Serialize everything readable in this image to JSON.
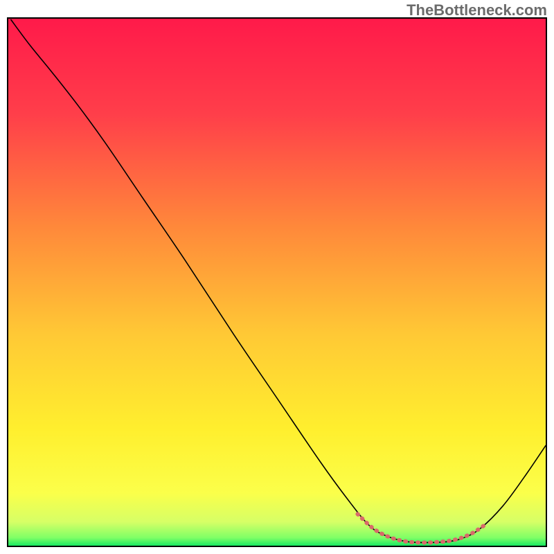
{
  "watermark": "TheBottleneck.com",
  "chart_data": {
    "type": "line",
    "title": "",
    "xlabel": "",
    "ylabel": "",
    "xlim": [
      0,
      100
    ],
    "ylim": [
      0,
      100
    ],
    "grid": false,
    "legend": null,
    "gradient_stops": [
      {
        "offset": 0.0,
        "color": "#ff1a4a"
      },
      {
        "offset": 0.18,
        "color": "#ff3e4a"
      },
      {
        "offset": 0.4,
        "color": "#ff8a3a"
      },
      {
        "offset": 0.6,
        "color": "#ffc935"
      },
      {
        "offset": 0.78,
        "color": "#ffef2e"
      },
      {
        "offset": 0.9,
        "color": "#fbff4a"
      },
      {
        "offset": 0.955,
        "color": "#d6ff66"
      },
      {
        "offset": 0.985,
        "color": "#7fff66"
      },
      {
        "offset": 1.0,
        "color": "#19e862"
      }
    ],
    "series": [
      {
        "name": "bottleneck-curve",
        "color": "#000000",
        "width": 1.6,
        "points": [
          {
            "x": 0.5,
            "y": 99.8
          },
          {
            "x": 4.0,
            "y": 95.0
          },
          {
            "x": 8.0,
            "y": 90.0
          },
          {
            "x": 13.0,
            "y": 83.5
          },
          {
            "x": 18.0,
            "y": 76.5
          },
          {
            "x": 25.0,
            "y": 66.0
          },
          {
            "x": 33.0,
            "y": 54.0
          },
          {
            "x": 42.0,
            "y": 40.0
          },
          {
            "x": 50.0,
            "y": 28.0
          },
          {
            "x": 58.0,
            "y": 16.0
          },
          {
            "x": 63.0,
            "y": 9.0
          },
          {
            "x": 67.0,
            "y": 4.0
          },
          {
            "x": 70.0,
            "y": 2.0
          },
          {
            "x": 74.0,
            "y": 0.8
          },
          {
            "x": 78.0,
            "y": 0.6
          },
          {
            "x": 82.0,
            "y": 0.8
          },
          {
            "x": 85.0,
            "y": 1.6
          },
          {
            "x": 88.0,
            "y": 3.4
          },
          {
            "x": 92.0,
            "y": 7.5
          },
          {
            "x": 96.0,
            "y": 13.0
          },
          {
            "x": 100.0,
            "y": 19.0
          }
        ]
      },
      {
        "name": "sweet-spot-highlight",
        "color": "#d86a6a",
        "width": 6,
        "dashed": true,
        "points": [
          {
            "x": 65.0,
            "y": 6.0
          },
          {
            "x": 68.0,
            "y": 3.2
          },
          {
            "x": 71.0,
            "y": 1.6
          },
          {
            "x": 74.0,
            "y": 0.8
          },
          {
            "x": 77.0,
            "y": 0.6
          },
          {
            "x": 80.0,
            "y": 0.7
          },
          {
            "x": 83.0,
            "y": 1.1
          },
          {
            "x": 86.0,
            "y": 2.2
          },
          {
            "x": 88.5,
            "y": 3.8
          }
        ]
      }
    ]
  }
}
